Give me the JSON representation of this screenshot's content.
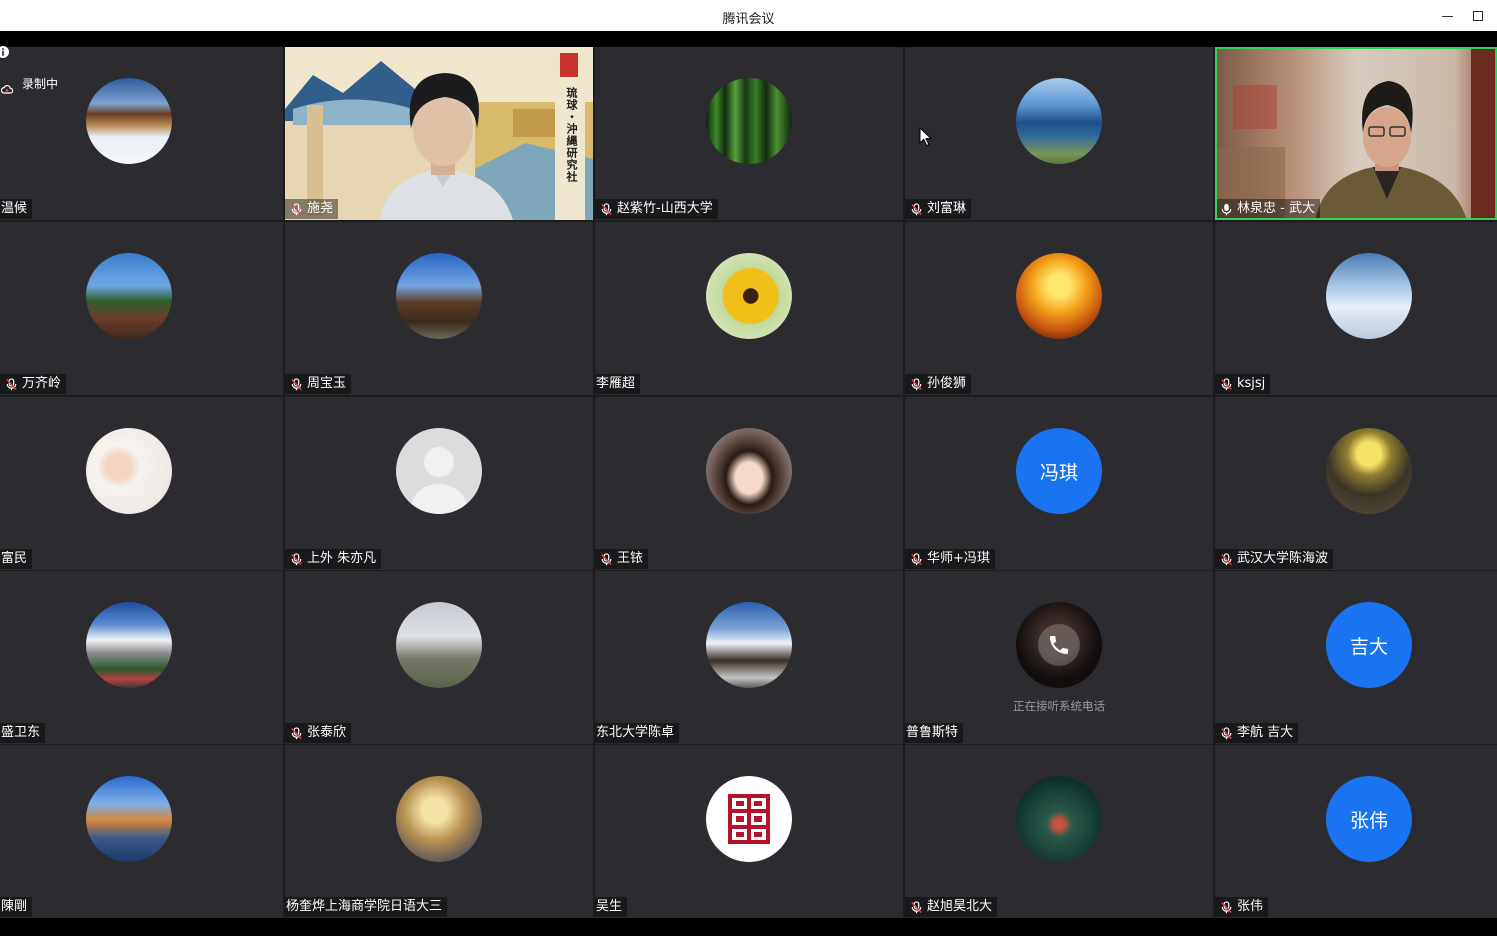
{
  "window": {
    "title": "腾讯会议",
    "controls": [
      {
        "icon": "minimize-icon"
      },
      {
        "icon": "maximize-icon"
      }
    ]
  },
  "overlay": {
    "info_icon": "info-icon",
    "recording": {
      "icon": "cloud-recording-icon",
      "label": "录制中"
    },
    "cursor_icon": "mouse-cursor-icon"
  },
  "colors": {
    "tile_background": "#2c2c30",
    "text_avatar": "#1a73f0",
    "speaking_border": "#2fd35a",
    "muted_slash": "#f0424a"
  },
  "participants": [
    {
      "name": "温候",
      "mic": null,
      "avatar": "snowy-cabin-photo"
    },
    {
      "name": "施尧",
      "mic": "muted",
      "avatar": "video-feed",
      "video": true,
      "video_text": "琉球・沖縄研究社"
    },
    {
      "name": "赵紫竹-山西大学",
      "mic": "muted",
      "avatar": "bamboo-photo"
    },
    {
      "name": "刘富琳",
      "mic": "muted",
      "avatar": "ocean-photo"
    },
    {
      "name": "林泉忠 - 武大",
      "mic": "on",
      "avatar": "video-feed",
      "video": true,
      "speaking": true
    },
    {
      "name": "万齐岭",
      "mic": "muted",
      "avatar": "palm-trees-photo"
    },
    {
      "name": "周宝玉",
      "mic": "muted",
      "avatar": "gate-photo"
    },
    {
      "name": "李雁超",
      "mic": null,
      "avatar": "sunflower-photo"
    },
    {
      "name": "孙俊狮",
      "mic": "muted",
      "avatar": "lion-sunset-photo"
    },
    {
      "name": "ksjsj",
      "mic": "muted",
      "avatar": "clouds-photo"
    },
    {
      "name": "富民",
      "mic": null,
      "avatar": "child-photo"
    },
    {
      "name": "上外 朱亦凡",
      "mic": "muted",
      "avatar": "default-avatar"
    },
    {
      "name": "王铱",
      "mic": "muted",
      "avatar": "girl-photo"
    },
    {
      "name": "华师+冯琪",
      "mic": "muted",
      "avatar": "text-avatar",
      "avatar_text": "冯琪"
    },
    {
      "name": "武汉大学陈海波",
      "mic": "muted",
      "avatar": "lamp-photo"
    },
    {
      "name": "盛卫东",
      "mic": null,
      "avatar": "snow-mountain-photo"
    },
    {
      "name": "张泰欣",
      "mic": "muted",
      "avatar": "building-statue-photo"
    },
    {
      "name": "东北大学陈卓",
      "mic": null,
      "avatar": "mountain-village-photo"
    },
    {
      "name": "普鲁斯特",
      "mic": null,
      "avatar": "phone-call-photo",
      "status": "正在接听系统电话"
    },
    {
      "name": "李航 吉大",
      "mic": "muted",
      "avatar": "text-avatar",
      "avatar_text": "吉大"
    },
    {
      "name": "陳剛",
      "mic": null,
      "avatar": "lake-photo"
    },
    {
      "name": "杨奎烨上海商学院日语大三",
      "mic": null,
      "avatar": "anime-photo"
    },
    {
      "name": "吴生",
      "mic": null,
      "avatar": "red-seal-logo"
    },
    {
      "name": "赵旭昊北大",
      "mic": "muted",
      "avatar": "dark-green-photo"
    },
    {
      "name": "张伟",
      "mic": "muted",
      "avatar": "text-avatar",
      "avatar_text": "张伟"
    }
  ]
}
